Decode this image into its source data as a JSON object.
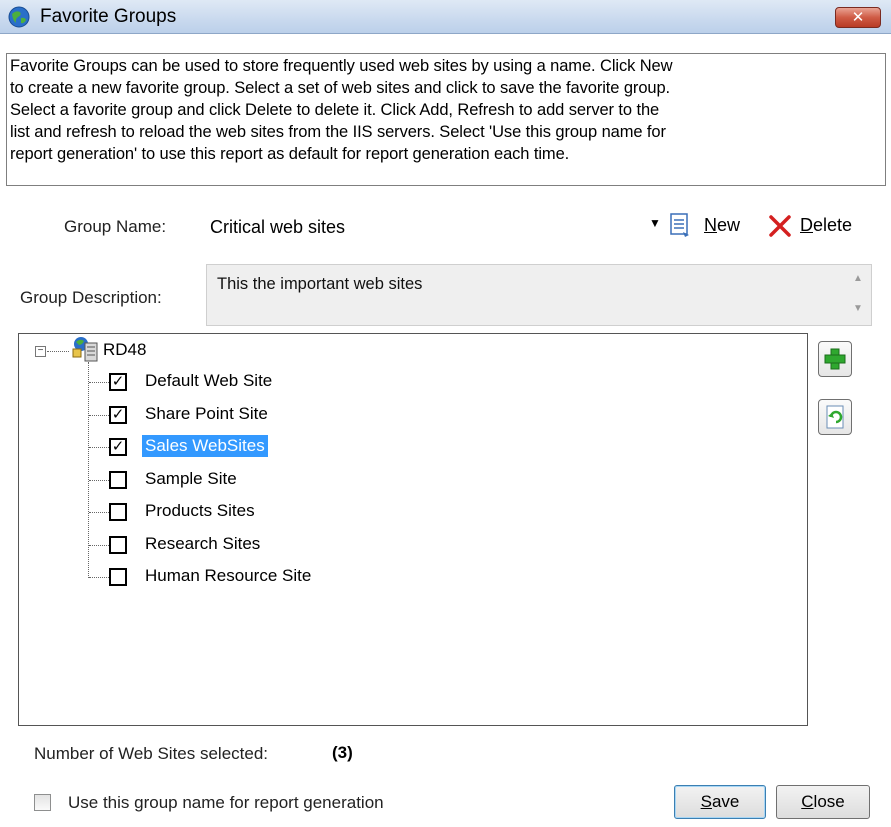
{
  "window": {
    "title": "Favorite Groups",
    "close_glyph": "✕"
  },
  "description_lines": [
    "Favorite Groups can be used to store frequently used web sites by using a name. Click New",
    "to create a new favorite group. Select a set of web sites and click to save the favorite group.",
    "Select a favorite group and click Delete to delete it. Click Add, Refresh to add server to the",
    "list and refresh to reload the web sites from the IIS servers. Select 'Use this group name for",
    "report generation' to use this report as default for report generation each time."
  ],
  "group_name": {
    "label": "Group Name:",
    "value": "Critical web sites",
    "new_label_first": "N",
    "new_label_rest": "ew",
    "delete_label_first": "D",
    "delete_label_rest": "elete"
  },
  "group_description": {
    "label": "Group Description:",
    "value": "This the important web sites"
  },
  "tree": {
    "server": "RD48",
    "sites": [
      {
        "label": "Default Web Site",
        "checked": true,
        "selected": false
      },
      {
        "label": "Share Point Site",
        "checked": true,
        "selected": false
      },
      {
        "label": "Sales WebSites",
        "checked": true,
        "selected": true
      },
      {
        "label": "Sample Site",
        "checked": false,
        "selected": false
      },
      {
        "label": "Products Sites",
        "checked": false,
        "selected": false
      },
      {
        "label": "Research Sites",
        "checked": false,
        "selected": false
      },
      {
        "label": "Human Resource Site",
        "checked": false,
        "selected": false
      }
    ]
  },
  "footer": {
    "count_label": "Number of Web Sites selected:",
    "count_value": "(3)",
    "use_group_label": "Use this group name for report generation",
    "use_group_checked": false,
    "save_first": "S",
    "save_rest": "ave",
    "close_first": "C",
    "close_rest": "lose"
  },
  "icons": {
    "title": "globe-icon",
    "new": "new-document-icon",
    "delete": "red-x-icon",
    "server": "server-icon",
    "add": "green-plus-icon",
    "refresh": "refresh-icon"
  },
  "colors": {
    "selection": "#3399ff",
    "delete_red": "#d42020",
    "add_green": "#2fa82f"
  }
}
